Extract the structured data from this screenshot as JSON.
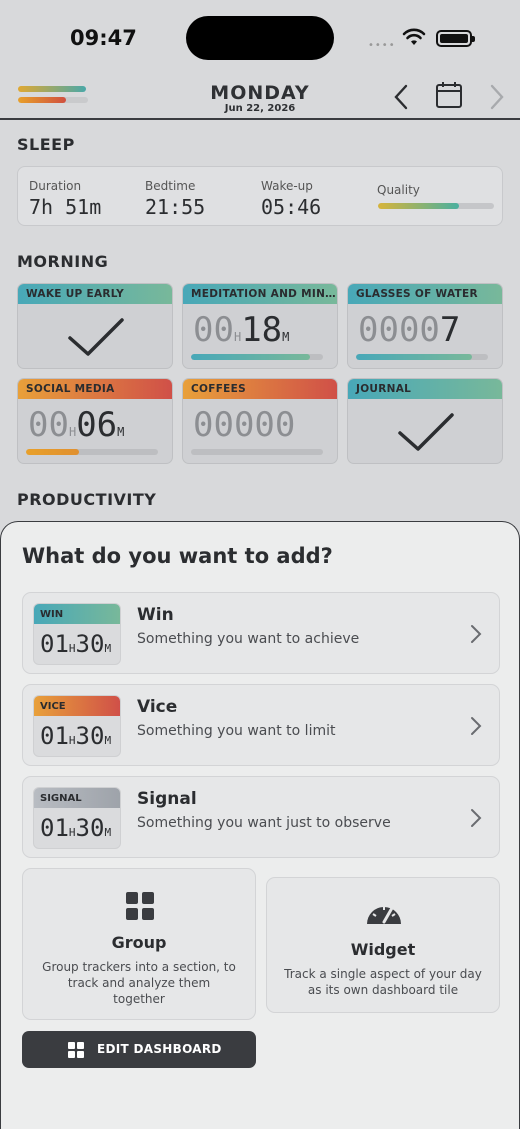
{
  "status": {
    "time": "09:47",
    "signal_dots": "•••• "
  },
  "header": {
    "day": "MONDAY",
    "date": "Jun 22, 2026"
  },
  "sleep": {
    "title": "SLEEP",
    "duration_label": "Duration",
    "duration_value": "7h 51m",
    "bedtime_label": "Bedtime",
    "bedtime_value": "21:55",
    "wakeup_label": "Wake-up",
    "wakeup_value": "05:46",
    "quality_label": "Quality",
    "quality_fraction": 0.7
  },
  "morning": {
    "title": "MORNING",
    "tiles": [
      {
        "label": "WAKE UP EARLY"
      },
      {
        "label": "MEDITATION AND MIN...",
        "hours": "00",
        "h_unit": "H",
        "minutes": "18",
        "m_unit": "M",
        "progress": 0.9
      },
      {
        "label": "GLASSES OF WATER",
        "value_dim": "0000",
        "value": "7",
        "progress": 0.88
      },
      {
        "label": "SOCIAL MEDIA",
        "hours": "00",
        "h_unit": "H",
        "minutes": "06",
        "m_unit": "M",
        "progress": 0.4
      },
      {
        "label": "COFFEES",
        "value_dim": "00000",
        "value": "",
        "progress": 0.0
      },
      {
        "label": "JOURNAL"
      }
    ]
  },
  "productivity": {
    "title": "PRODUCTIVITY"
  },
  "sheet": {
    "title": "What do you want to add?",
    "options": [
      {
        "tag": "WIN",
        "name": "Win",
        "desc": "Something you want to achieve",
        "hours": "01",
        "h_unit": "H",
        "minutes": "30",
        "m_unit": "M"
      },
      {
        "tag": "VICE",
        "name": "Vice",
        "desc": "Something you want to limit",
        "hours": "01",
        "h_unit": "H",
        "minutes": "30",
        "m_unit": "M"
      },
      {
        "tag": "SIGNAL",
        "name": "Signal",
        "desc": "Something you want just to observe",
        "hours": "01",
        "h_unit": "H",
        "minutes": "30",
        "m_unit": "M"
      }
    ],
    "group": {
      "title": "Group",
      "desc_1": "Group trackers into a section, to",
      "desc_2": "track and analyze them",
      "desc_3": "together"
    },
    "widget": {
      "title": "Widget",
      "desc_1": "Track a single aspect of your day",
      "desc_2": "as its own dashboard tile"
    },
    "edit_label": "EDIT DASHBOARD"
  },
  "colors": {
    "teal": "#48a8b8",
    "vice": "#d05048",
    "dark": "#3a3c40"
  }
}
